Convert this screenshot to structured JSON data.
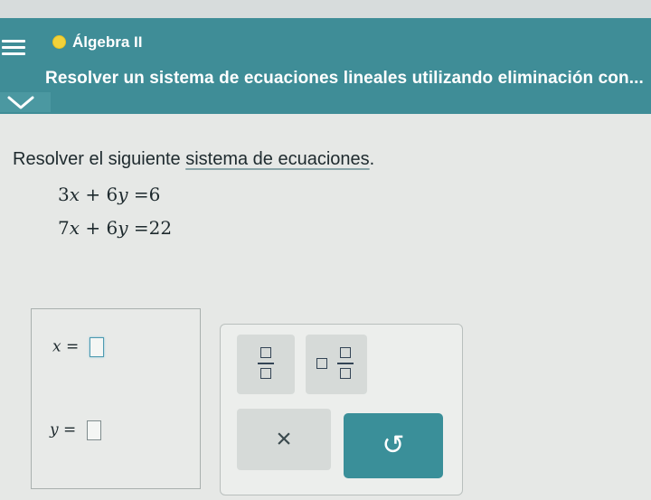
{
  "header": {
    "course": "Álgebra II",
    "lesson_title": "Resolver un sistema de ecuaciones lineales utilizando eliminación con..."
  },
  "problem": {
    "prompt_prefix": "Resolver el siguiente ",
    "prompt_link": "sistema de ecuaciones",
    "prompt_suffix": ".",
    "equations": [
      {
        "a": "3",
        "b": "+",
        "c": "6",
        "rhs": "6"
      },
      {
        "a": "7",
        "b": "+",
        "c": "6",
        "rhs": "22"
      }
    ],
    "var_x": "x",
    "var_y": "y"
  },
  "answer": {
    "x_label": "x",
    "y_label": "y",
    "equals": "=",
    "x_value": "",
    "y_value": ""
  },
  "keypad": {
    "clear_symbol": "×",
    "undo_symbol": "↺"
  },
  "colors": {
    "header_bg": "#3f8d97",
    "status_dot": "#f2d23a",
    "undo_button": "#3a8f99"
  }
}
